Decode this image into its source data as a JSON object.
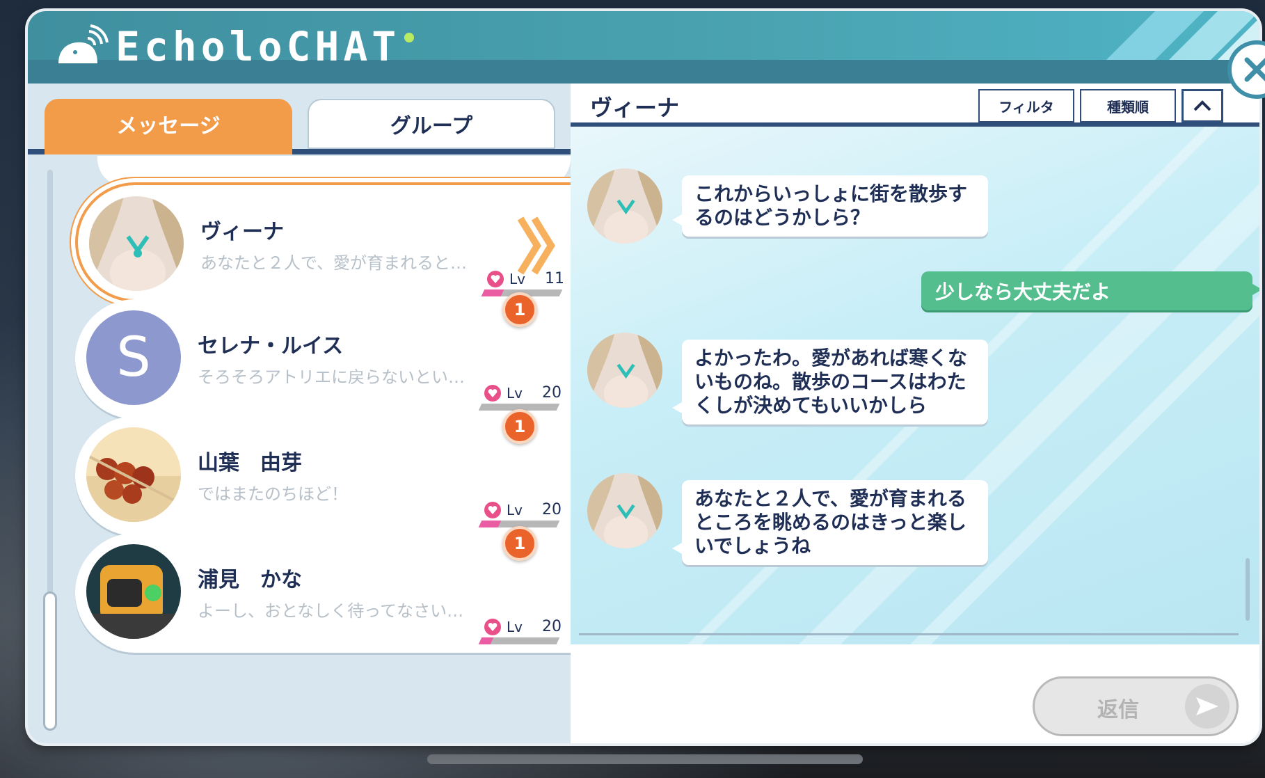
{
  "app": {
    "title": "EcholoCHAT"
  },
  "tabs": {
    "messages": "メッセージ",
    "group": "グループ"
  },
  "conversations": [
    {
      "name": "ヴィーナ",
      "preview": "あなたと２人で、愛が育まれると…",
      "lv_label": "Lv",
      "level": "11",
      "affinity_fill": 0.25,
      "unread": "",
      "selected": true
    },
    {
      "name": "セレナ・ルイス",
      "preview": "そろそろアトリエに戻らないとい…",
      "lv_label": "Lv",
      "level": "20",
      "affinity_fill": 0.0,
      "unread": "1",
      "avatar_letter": "S"
    },
    {
      "name": "山葉　由芽",
      "preview": "ではまたのちほど！",
      "lv_label": "Lv",
      "level": "20",
      "affinity_fill": 0.25,
      "unread": "1"
    },
    {
      "name": "浦見　かな",
      "preview": "よーし、おとなしく待ってなさい…",
      "lv_label": "Lv",
      "level": "20",
      "affinity_fill": 0.15,
      "unread": "1"
    }
  ],
  "chat": {
    "contact_name": "ヴィーナ",
    "filter_label": "フィルタ",
    "sort_label": "種類順",
    "messages": [
      {
        "from": "contact",
        "text": "これからいっしょに街を散歩するのはどうかしら？"
      },
      {
        "from": "me",
        "text": "少しなら大丈夫だよ"
      },
      {
        "from": "contact",
        "text": "よかったわ。愛があれば寒くないものね。散歩のコースはわたくしが決めてもいいかしら"
      },
      {
        "from": "contact",
        "text": "あなたと２人で、愛が育まれるところを眺めるのはきっと楽しいでしょうね"
      }
    ],
    "reply_label": "返信"
  },
  "colors": {
    "accent_orange": "#f29c4a",
    "header_teal": "#4aa3b1",
    "my_bubble": "#55be8f",
    "navy_text": "#1f2e55",
    "badge": "#e9632b"
  },
  "icons": {
    "close": "close-icon",
    "collapse": "chevron-up-icon",
    "send": "send-arrow-icon",
    "heart": "heart-icon",
    "logo": "whale-signal-icon"
  }
}
